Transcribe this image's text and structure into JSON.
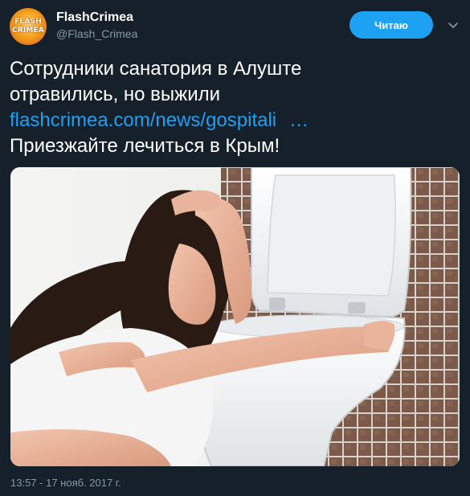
{
  "account": {
    "avatar_text_top": "FLASH",
    "avatar_text_bottom": "CRIMEA",
    "display_name": "FlashCrimea",
    "handle": "@Flash_Crimea"
  },
  "follow_button": {
    "label": "Читаю"
  },
  "tweet": {
    "line1": "Сотрудники санатория в Алуште",
    "line2": "отравились, но выжили",
    "link": "flashcrimea.com/news/gospitali",
    "link_ellipsis": "…",
    "line4": "Приезжайте лечиться в Крым!"
  },
  "timestamp": "13:57 - 17 нояб. 2017 г.",
  "colors": {
    "background": "#15202b",
    "accent": "#1da1f2",
    "secondary_text": "#8899a6"
  },
  "icons": {
    "menu": "chevron-down-icon"
  }
}
